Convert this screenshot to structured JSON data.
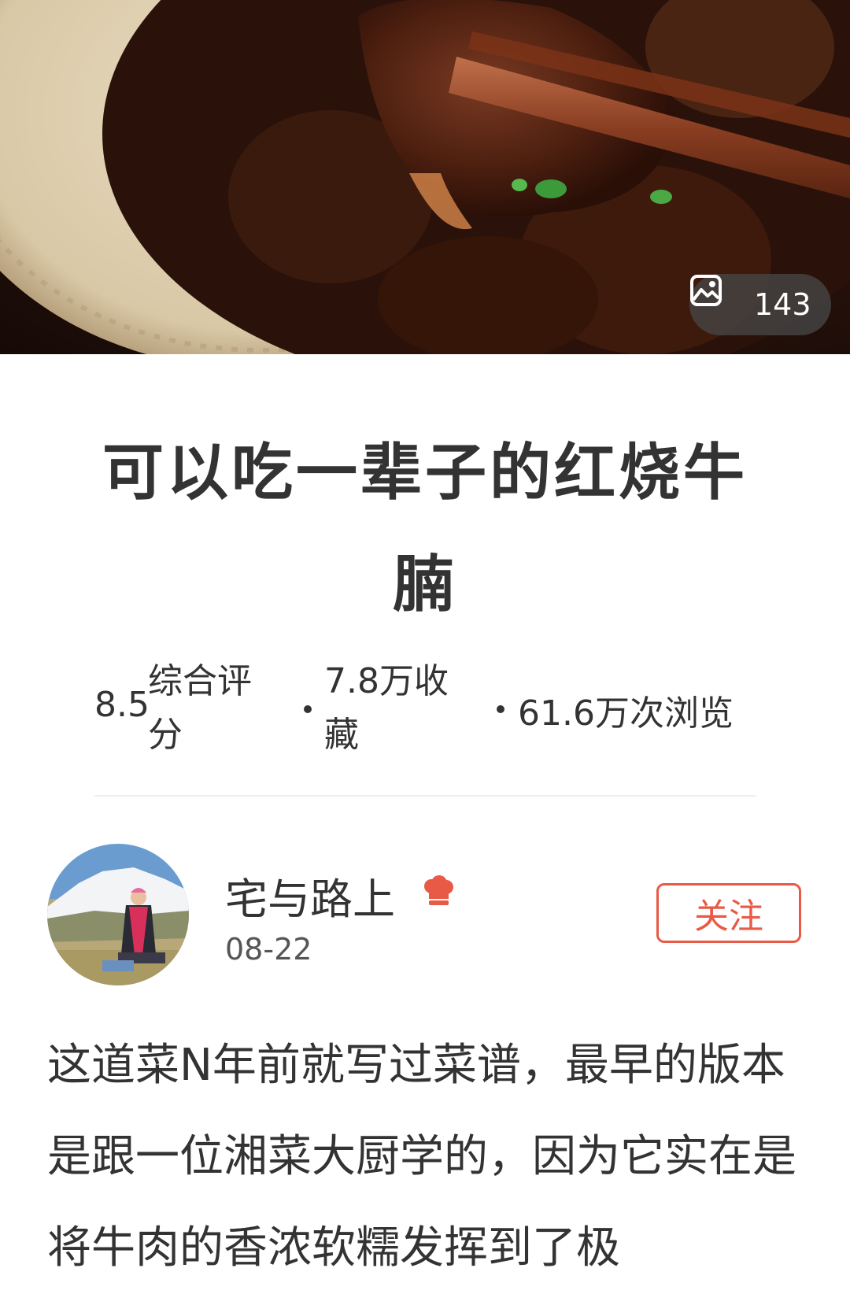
{
  "hero": {
    "photo_count": "143",
    "icons": {
      "photo": "image-icon"
    }
  },
  "recipe": {
    "title": "可以吃一辈子的红烧牛腩",
    "rating": "8.5",
    "rating_label": "综合评分",
    "favorites": "7.8万收藏",
    "views": "61.6万次浏览"
  },
  "author": {
    "name": "宅与路上",
    "date": "08-22",
    "badge_icon": "chef-hat-icon",
    "follow_label": "关注"
  },
  "description": "这道菜N年前就写过菜谱，最早的版本是跟一位湘菜大厨学的，因为它实在是将牛肉的香浓软糯发挥到了极",
  "colors": {
    "accent": "#e85a45",
    "text": "#333333"
  }
}
